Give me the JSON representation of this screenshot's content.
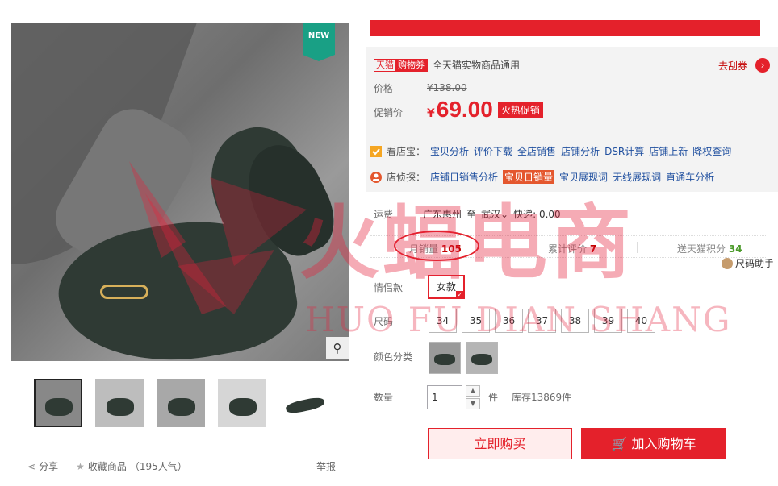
{
  "gallery": {
    "new_badge": "NEW",
    "zoom_icon": "magnifier-icon",
    "thumbnail_count": 5
  },
  "social": {
    "share_label": "分享",
    "favorite_label": "收藏商品",
    "favorite_count": "（195人气）",
    "report_label": "举报"
  },
  "coupon": {
    "tag_part1": "天猫",
    "tag_part2": "购物券",
    "text": "全天猫实物商品通用",
    "link": "去刮券",
    "arrow": "›"
  },
  "price": {
    "orig_label": "价格",
    "orig_value": "¥138.00",
    "promo_label": "促销价",
    "currency": "¥",
    "promo_value": "69.00",
    "promo_tag": "火热促销"
  },
  "tools": {
    "row1_label": "看店宝：",
    "row1_links": [
      "宝贝分析",
      "评价下载",
      "全店销售",
      "店铺分析",
      "DSR计算",
      "店铺上新",
      "降权查询"
    ],
    "row2_label": "店侦探：",
    "row2_links": [
      "店铺日销售分析",
      "宝贝日销量",
      "宝贝展现词",
      "无线展现词",
      "直通车分析"
    ]
  },
  "shipping": {
    "label": "运费",
    "from": "广东惠州",
    "to_word": "至",
    "to": "武汉",
    "express": "快递: 0.00"
  },
  "stats": {
    "monthly_sales_label": "月销量",
    "monthly_sales": "105",
    "reviews_label": "累计评价",
    "reviews": "7",
    "points_label": "送天猫积分",
    "points": "34",
    "size_helper": "尺码助手"
  },
  "options": {
    "style_label": "情侣款",
    "style_value": "女款",
    "size_label": "尺码",
    "sizes": [
      "34",
      "35",
      "36",
      "37",
      "38",
      "39",
      "40"
    ],
    "color_label": "颜色分类"
  },
  "quantity": {
    "label": "数量",
    "value": "1",
    "unit": "件",
    "stock": "库存13869件"
  },
  "actions": {
    "buy_now": "立即购买",
    "add_cart": "加入购物车",
    "cart_icon": "cart-icon"
  },
  "watermark": {
    "main": "火蝠电商",
    "sub": "HUO FU DIAN SHANG"
  },
  "colors": {
    "accent": "#e4212b",
    "link": "#1f4f9f",
    "green": "#4b9a2a",
    "badge": "#19a085"
  }
}
